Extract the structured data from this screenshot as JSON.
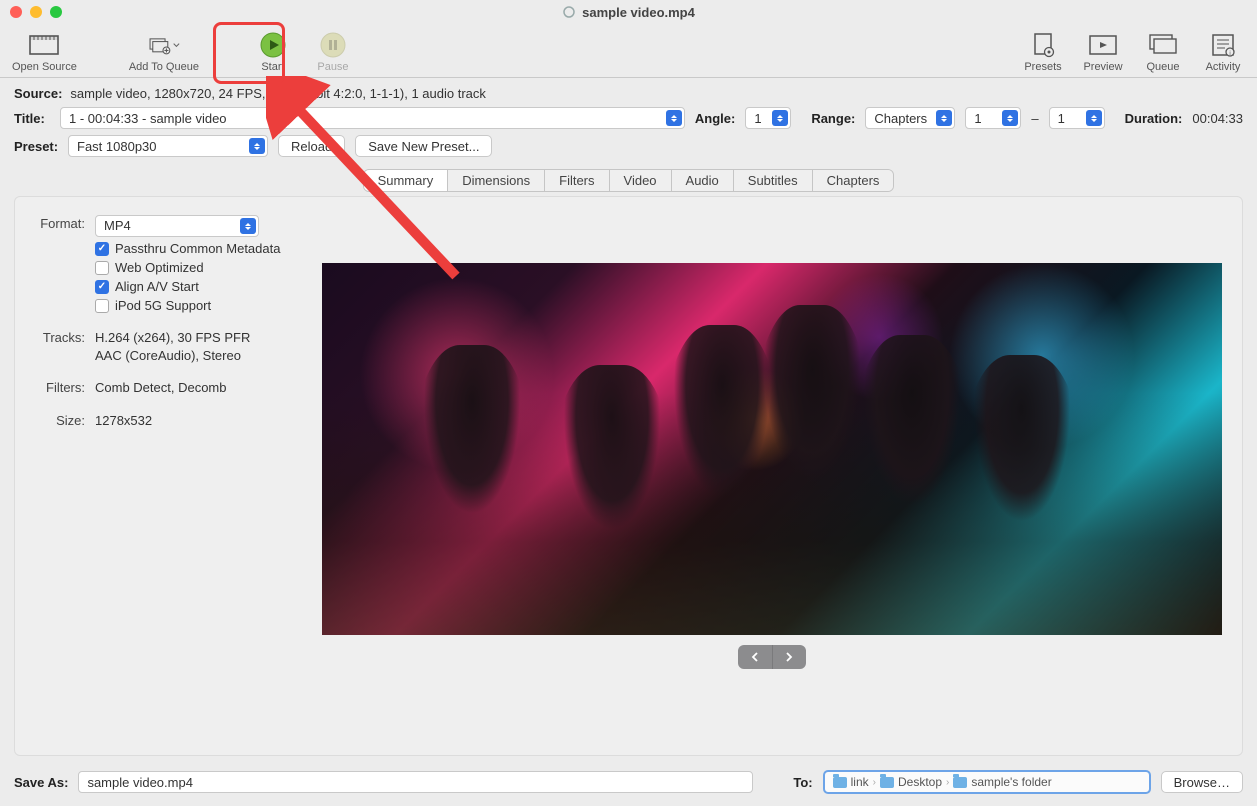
{
  "window": {
    "title": "sample video.mp4"
  },
  "toolbar": {
    "open_source": "Open Source",
    "add_to_queue": "Add To Queue",
    "start": "Start",
    "pause": "Pause",
    "presets": "Presets",
    "preview": "Preview",
    "queue": "Queue",
    "activity": "Activity"
  },
  "source": {
    "label": "Source:",
    "value": "sample video, 1280x720, 24 FPS, SDR (8-bit 4:2:0, 1-1-1), 1 audio track"
  },
  "title_row": {
    "label": "Title:",
    "value": "1 - 00:04:33 - sample video",
    "angle_label": "Angle:",
    "angle_value": "1",
    "range_label": "Range:",
    "range_type": "Chapters",
    "range_from": "1",
    "range_sep": "–",
    "range_to": "1",
    "duration_label": "Duration:",
    "duration_value": "00:04:33"
  },
  "preset_row": {
    "label": "Preset:",
    "value": "Fast 1080p30",
    "reload": "Reload",
    "save_new": "Save New Preset..."
  },
  "tabs": [
    "Summary",
    "Dimensions",
    "Filters",
    "Video",
    "Audio",
    "Subtitles",
    "Chapters"
  ],
  "summary": {
    "format_label": "Format:",
    "format_value": "MP4",
    "passthru": "Passthru Common Metadata",
    "web_opt": "Web Optimized",
    "align_av": "Align A/V Start",
    "ipod": "iPod 5G Support",
    "tracks_label": "Tracks:",
    "tracks_value1": "H.264 (x264), 30 FPS PFR",
    "tracks_value2": "AAC (CoreAudio), Stereo",
    "filters_label": "Filters:",
    "filters_value": "Comb Detect, Decomb",
    "size_label": "Size:",
    "size_value": "1278x532"
  },
  "bottom": {
    "save_as_label": "Save As:",
    "save_as_value": "sample video.mp4",
    "to_label": "To:",
    "path_parts": [
      "link",
      "Desktop",
      "sample's folder"
    ],
    "browse": "Browse…"
  }
}
